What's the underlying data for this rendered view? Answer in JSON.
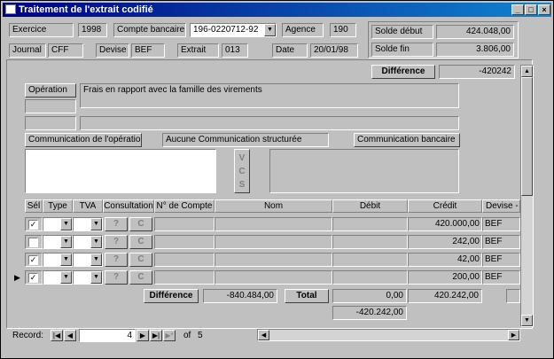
{
  "window": {
    "title": "Traitement de l'extrait codifié"
  },
  "header": {
    "exercice_label": "Exercice",
    "exercice_value": "1998",
    "compte_label": "Compte bancaire",
    "compte_value": "196-0220712-92",
    "agence_label": "Agence",
    "agence_value": "190",
    "journal_label": "Journal",
    "journal_value": "CFF",
    "devise_label": "Devise",
    "devise_value": "BEF",
    "extrait_label": "Extrait",
    "extrait_value": "013",
    "date_label": "Date",
    "date_value": "20/01/98",
    "solde_debut_label": "Solde début",
    "solde_debut_value": "424.048,00",
    "solde_fin_label": "Solde fin",
    "solde_fin_value": "3.806,00",
    "difference_label": "Différence",
    "difference_value": "-420242"
  },
  "operation": {
    "label": "Opération",
    "text": "Frais en rapport avec la famille des virements",
    "comm_operation_label": "Communication de l'opération",
    "comm_structuree": "Aucune Communication structurée",
    "comm_bancaire_label": "Communication bancaire",
    "vcs": [
      "V",
      "C",
      "S"
    ]
  },
  "grid": {
    "columns": [
      "Sél",
      "Type",
      "TVA",
      "Consultation",
      "N° de Compte",
      "Nom",
      "Débit",
      "Crédit",
      "Devise - M"
    ],
    "btn_q": "?",
    "btn_c": "C",
    "rows": [
      {
        "checked": "✓",
        "credit": "420.000,00",
        "devise": "BEF"
      },
      {
        "checked": "",
        "credit": "242,00",
        "devise": "BEF"
      },
      {
        "checked": "✓",
        "credit": "42,00",
        "devise": "BEF"
      },
      {
        "checked": "✓",
        "credit": "200,00",
        "devise": "BEF"
      }
    ],
    "footer": {
      "difference_label": "Différence",
      "difference_value": "-840.484,00",
      "total_label": "Total",
      "total_debit": "0,00",
      "total_credit": "420.242,00",
      "balance": "-420.242,00"
    }
  },
  "nav": {
    "record_label": "Record:",
    "current": "4",
    "of_label": "of",
    "total": "5"
  }
}
